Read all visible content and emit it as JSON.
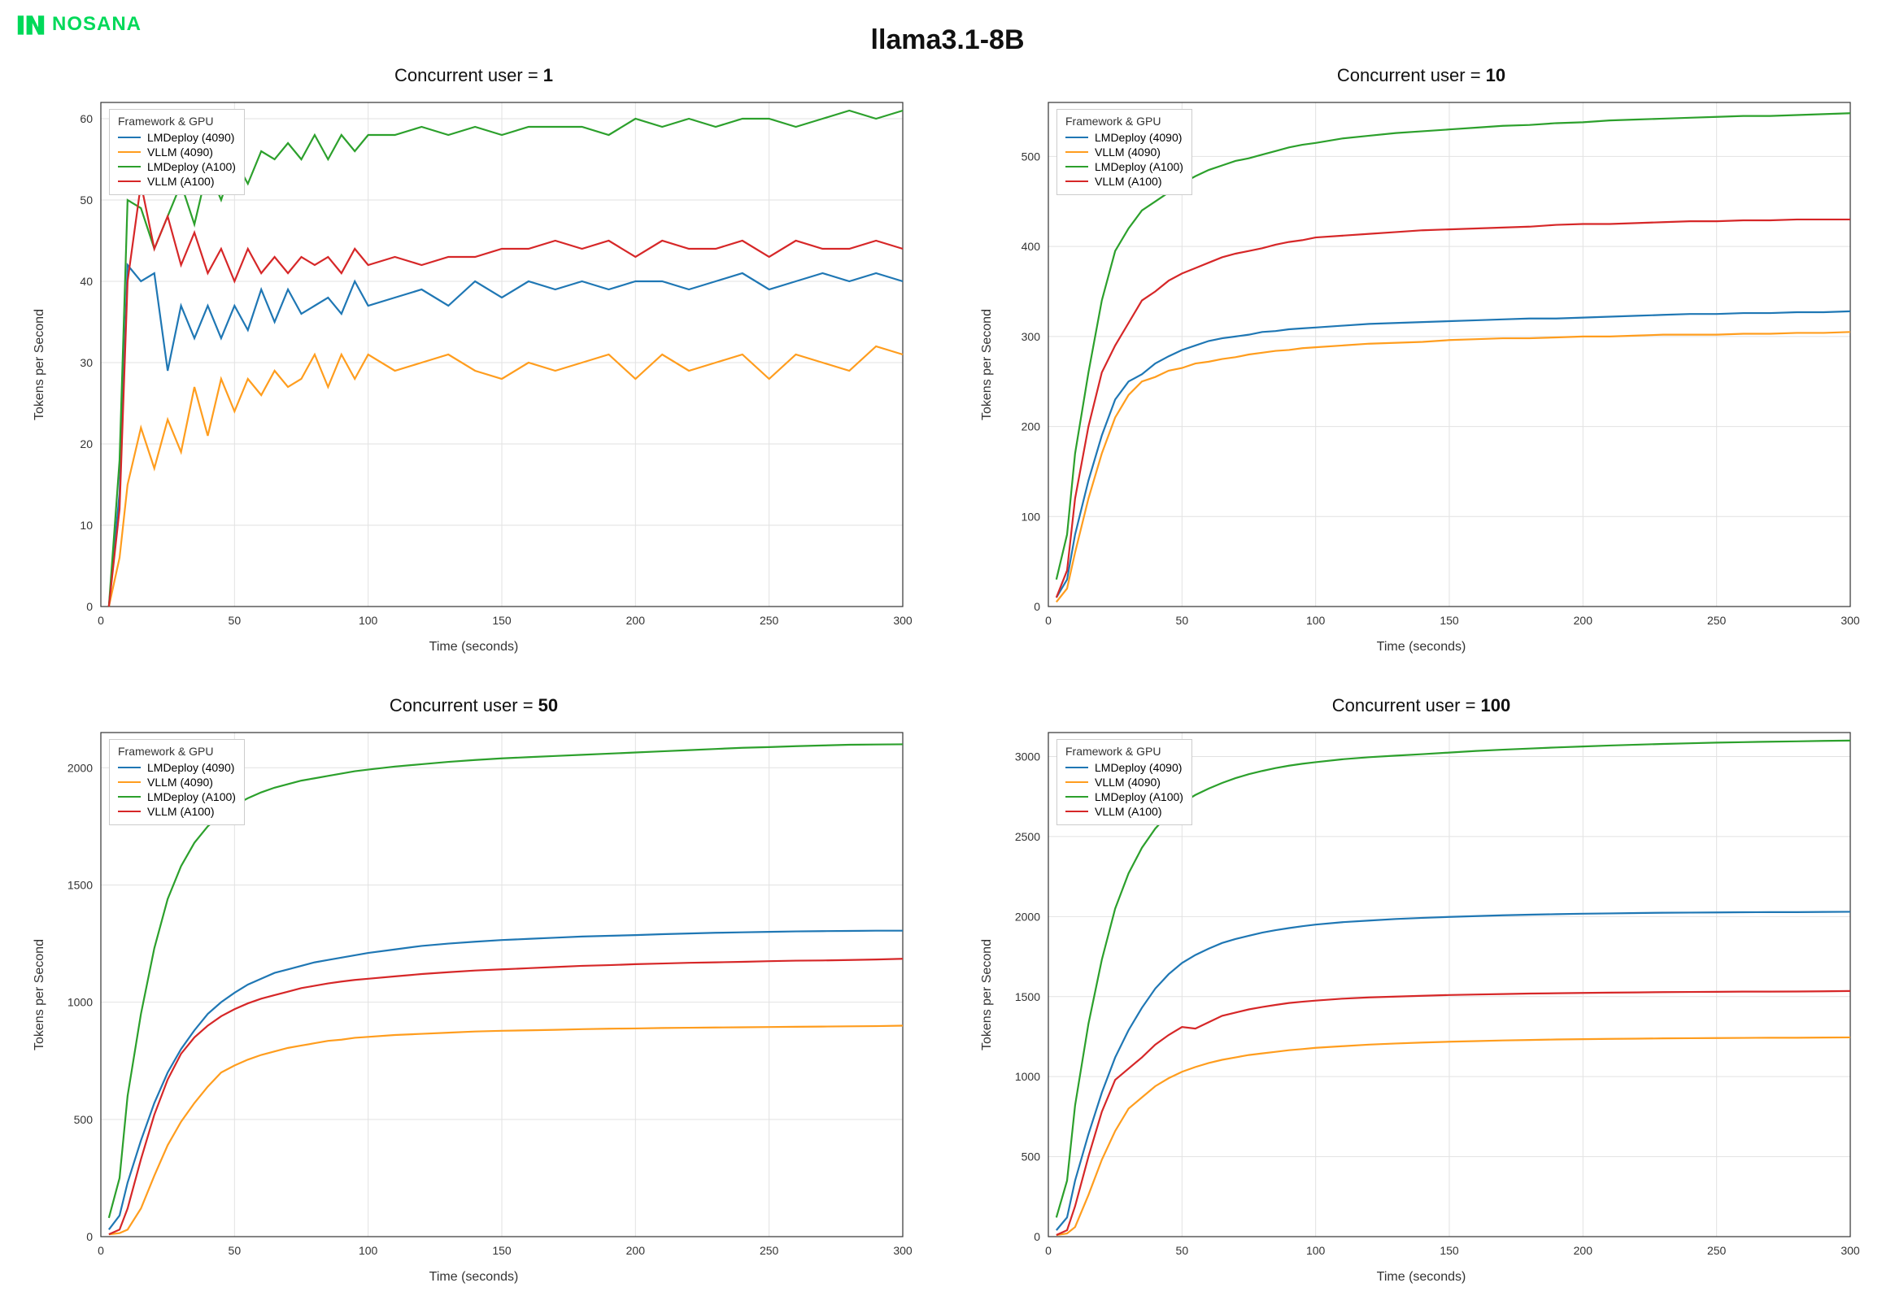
{
  "logo_text": "NOSANA",
  "super_title": "llama3.1-8B",
  "ylabel": "Tokens per Second",
  "xlabel": "Time (seconds)",
  "legend_title": "Framework & GPU",
  "colors": {
    "lmdeploy_4090": "#1f77b4",
    "vllm_4090": "#ff9d1e",
    "lmdeploy_a100": "#2ca02c",
    "vllm_a100": "#d62728"
  },
  "series_meta": [
    {
      "key": "lmdeploy_4090",
      "name": "LMDeploy (4090)"
    },
    {
      "key": "vllm_4090",
      "name": "VLLM (4090)"
    },
    {
      "key": "lmdeploy_a100",
      "name": "LMDeploy (A100)"
    },
    {
      "key": "vllm_a100",
      "name": "VLLM (A100)"
    }
  ],
  "chart_data": [
    {
      "type": "line",
      "title_prefix": "Concurrent user = ",
      "title_value": "1",
      "xlabel": "Time (seconds)",
      "ylabel": "Tokens per Second",
      "xlim": [
        0,
        300
      ],
      "ylim": [
        0,
        62
      ],
      "xticks": [
        0,
        50,
        100,
        150,
        200,
        250,
        300
      ],
      "yticks": [
        0,
        10,
        20,
        30,
        40,
        50,
        60
      ],
      "x": [
        3,
        7,
        10,
        15,
        20,
        25,
        30,
        35,
        40,
        45,
        50,
        55,
        60,
        65,
        70,
        75,
        80,
        85,
        90,
        95,
        100,
        110,
        120,
        130,
        140,
        150,
        160,
        170,
        180,
        190,
        200,
        210,
        220,
        230,
        240,
        250,
        260,
        270,
        280,
        290,
        300
      ],
      "series": [
        {
          "name": "LMDeploy (4090)",
          "key": "lmdeploy_4090",
          "values": [
            0,
            14,
            42,
            40,
            41,
            29,
            37,
            33,
            37,
            33,
            37,
            34,
            39,
            35,
            39,
            36,
            37,
            38,
            36,
            40,
            37,
            38,
            39,
            37,
            40,
            38,
            40,
            39,
            40,
            39,
            40,
            40,
            39,
            40,
            41,
            39,
            40,
            41,
            40,
            41,
            40
          ]
        },
        {
          "name": "VLLM (4090)",
          "key": "vllm_4090",
          "values": [
            0,
            6,
            15,
            22,
            17,
            23,
            19,
            27,
            21,
            28,
            24,
            28,
            26,
            29,
            27,
            28,
            31,
            27,
            31,
            28,
            31,
            29,
            30,
            31,
            29,
            28,
            30,
            29,
            30,
            31,
            28,
            31,
            29,
            30,
            31,
            28,
            31,
            30,
            29,
            32,
            31
          ]
        },
        {
          "name": "LMDeploy (A100)",
          "key": "lmdeploy_a100",
          "values": [
            0,
            18,
            50,
            49,
            44,
            48,
            52,
            47,
            54,
            50,
            55,
            52,
            56,
            55,
            57,
            55,
            58,
            55,
            58,
            56,
            58,
            58,
            59,
            58,
            59,
            58,
            59,
            59,
            59,
            58,
            60,
            59,
            60,
            59,
            60,
            60,
            59,
            60,
            61,
            60,
            61
          ]
        },
        {
          "name": "VLLM (A100)",
          "key": "vllm_a100",
          "values": [
            0,
            12,
            40,
            52,
            44,
            48,
            42,
            46,
            41,
            44,
            40,
            44,
            41,
            43,
            41,
            43,
            42,
            43,
            41,
            44,
            42,
            43,
            42,
            43,
            43,
            44,
            44,
            45,
            44,
            45,
            43,
            45,
            44,
            44,
            45,
            43,
            45,
            44,
            44,
            45,
            44
          ]
        }
      ]
    },
    {
      "type": "line",
      "title_prefix": "Concurrent user = ",
      "title_value": "10",
      "xlabel": "Time (seconds)",
      "ylabel": "Tokens per Second",
      "xlim": [
        0,
        300
      ],
      "ylim": [
        0,
        560
      ],
      "xticks": [
        0,
        50,
        100,
        150,
        200,
        250,
        300
      ],
      "yticks": [
        0,
        100,
        200,
        300,
        400,
        500
      ],
      "x": [
        3,
        7,
        10,
        15,
        20,
        25,
        30,
        35,
        40,
        45,
        50,
        55,
        60,
        65,
        70,
        75,
        80,
        85,
        90,
        95,
        100,
        110,
        120,
        130,
        140,
        150,
        160,
        170,
        180,
        190,
        200,
        210,
        220,
        230,
        240,
        250,
        260,
        270,
        280,
        290,
        300
      ],
      "series": [
        {
          "name": "LMDeploy (4090)",
          "key": "lmdeploy_4090",
          "values": [
            10,
            30,
            80,
            140,
            190,
            230,
            250,
            258,
            270,
            278,
            285,
            290,
            295,
            298,
            300,
            302,
            305,
            306,
            308,
            309,
            310,
            312,
            314,
            315,
            316,
            317,
            318,
            319,
            320,
            320,
            321,
            322,
            323,
            324,
            325,
            325,
            326,
            326,
            327,
            327,
            328
          ]
        },
        {
          "name": "VLLM (4090)",
          "key": "vllm_4090",
          "values": [
            5,
            20,
            60,
            120,
            170,
            210,
            235,
            250,
            255,
            262,
            265,
            270,
            272,
            275,
            277,
            280,
            282,
            284,
            285,
            287,
            288,
            290,
            292,
            293,
            294,
            296,
            297,
            298,
            298,
            299,
            300,
            300,
            301,
            302,
            302,
            302,
            303,
            303,
            304,
            304,
            305
          ]
        },
        {
          "name": "LMDeploy (A100)",
          "key": "lmdeploy_a100",
          "values": [
            30,
            80,
            170,
            260,
            340,
            395,
            420,
            440,
            450,
            460,
            470,
            478,
            485,
            490,
            495,
            498,
            502,
            506,
            510,
            513,
            515,
            520,
            523,
            526,
            528,
            530,
            532,
            534,
            535,
            537,
            538,
            540,
            541,
            542,
            543,
            544,
            545,
            545,
            546,
            547,
            548
          ]
        },
        {
          "name": "VLLM (A100)",
          "key": "vllm_a100",
          "values": [
            10,
            40,
            120,
            200,
            260,
            290,
            315,
            340,
            350,
            362,
            370,
            376,
            382,
            388,
            392,
            395,
            398,
            402,
            405,
            407,
            410,
            412,
            414,
            416,
            418,
            419,
            420,
            421,
            422,
            424,
            425,
            425,
            426,
            427,
            428,
            428,
            429,
            429,
            430,
            430,
            430
          ]
        }
      ]
    },
    {
      "type": "line",
      "title_prefix": "Concurrent user = ",
      "title_value": "50",
      "xlabel": "Time (seconds)",
      "ylabel": "Tokens per Second",
      "xlim": [
        0,
        300
      ],
      "ylim": [
        0,
        2150
      ],
      "xticks": [
        0,
        50,
        100,
        150,
        200,
        250,
        300
      ],
      "yticks": [
        0,
        500,
        1000,
        1500,
        2000
      ],
      "x": [
        3,
        7,
        10,
        15,
        20,
        25,
        30,
        35,
        40,
        45,
        50,
        55,
        60,
        65,
        70,
        75,
        80,
        85,
        90,
        95,
        100,
        110,
        120,
        130,
        140,
        150,
        160,
        170,
        180,
        190,
        200,
        210,
        220,
        230,
        240,
        250,
        260,
        270,
        280,
        290,
        300
      ],
      "series": [
        {
          "name": "LMDeploy (4090)",
          "key": "lmdeploy_4090",
          "values": [
            30,
            90,
            230,
            410,
            570,
            700,
            800,
            880,
            950,
            1000,
            1040,
            1075,
            1100,
            1125,
            1140,
            1155,
            1170,
            1180,
            1190,
            1200,
            1210,
            1225,
            1240,
            1250,
            1258,
            1265,
            1270,
            1275,
            1280,
            1283,
            1286,
            1290,
            1293,
            1296,
            1298,
            1300,
            1302,
            1303,
            1304,
            1305,
            1305
          ]
        },
        {
          "name": "VLLM (4090)",
          "key": "vllm_4090",
          "values": [
            10,
            15,
            30,
            120,
            260,
            390,
            490,
            570,
            640,
            700,
            730,
            755,
            775,
            790,
            805,
            815,
            825,
            835,
            840,
            848,
            852,
            860,
            865,
            870,
            875,
            878,
            880,
            882,
            885,
            887,
            888,
            890,
            891,
            892,
            893,
            894,
            895,
            896,
            897,
            898,
            900
          ]
        },
        {
          "name": "LMDeploy (A100)",
          "key": "lmdeploy_a100",
          "values": [
            80,
            250,
            600,
            950,
            1230,
            1440,
            1580,
            1680,
            1750,
            1800,
            1840,
            1870,
            1895,
            1915,
            1930,
            1945,
            1955,
            1965,
            1975,
            1985,
            1992,
            2005,
            2015,
            2025,
            2033,
            2040,
            2045,
            2050,
            2055,
            2060,
            2065,
            2070,
            2075,
            2080,
            2085,
            2088,
            2092,
            2095,
            2098,
            2099,
            2100
          ]
        },
        {
          "name": "VLLM (A100)",
          "key": "vllm_a100",
          "values": [
            10,
            30,
            120,
            330,
            520,
            670,
            780,
            850,
            900,
            940,
            970,
            995,
            1015,
            1030,
            1045,
            1060,
            1070,
            1080,
            1088,
            1095,
            1100,
            1110,
            1120,
            1128,
            1135,
            1140,
            1145,
            1150,
            1155,
            1158,
            1162,
            1165,
            1168,
            1170,
            1172,
            1175,
            1177,
            1178,
            1180,
            1182,
            1185
          ]
        }
      ]
    },
    {
      "type": "line",
      "title_prefix": "Concurrent user = ",
      "title_value": "100",
      "xlabel": "Time (seconds)",
      "ylabel": "Tokens per Second",
      "xlim": [
        0,
        300
      ],
      "ylim": [
        0,
        3150
      ],
      "xticks": [
        0,
        50,
        100,
        150,
        200,
        250,
        300
      ],
      "yticks": [
        0,
        500,
        1000,
        1500,
        2000,
        2500,
        3000
      ],
      "x": [
        3,
        7,
        10,
        15,
        20,
        25,
        30,
        35,
        40,
        45,
        50,
        55,
        60,
        65,
        70,
        75,
        80,
        85,
        90,
        95,
        100,
        110,
        120,
        130,
        140,
        150,
        160,
        170,
        180,
        190,
        200,
        210,
        220,
        230,
        240,
        250,
        260,
        270,
        280,
        290,
        300
      ],
      "series": [
        {
          "name": "LMDeploy (4090)",
          "key": "lmdeploy_4090",
          "values": [
            40,
            120,
            350,
            640,
            900,
            1120,
            1290,
            1430,
            1550,
            1640,
            1710,
            1760,
            1800,
            1835,
            1860,
            1880,
            1900,
            1915,
            1928,
            1940,
            1950,
            1965,
            1975,
            1985,
            1992,
            1998,
            2003,
            2008,
            2012,
            2015,
            2018,
            2020,
            2022,
            2024,
            2025,
            2026,
            2027,
            2028,
            2028,
            2029,
            2030
          ]
        },
        {
          "name": "VLLM (4090)",
          "key": "vllm_4090",
          "values": [
            10,
            20,
            60,
            260,
            480,
            660,
            800,
            870,
            940,
            990,
            1030,
            1060,
            1085,
            1105,
            1120,
            1135,
            1145,
            1155,
            1165,
            1172,
            1180,
            1190,
            1200,
            1207,
            1213,
            1218,
            1222,
            1226,
            1229,
            1232,
            1234,
            1236,
            1237,
            1239,
            1240,
            1241,
            1242,
            1243,
            1243,
            1244,
            1245
          ]
        },
        {
          "name": "LMDeploy (A100)",
          "key": "lmdeploy_a100",
          "values": [
            120,
            350,
            820,
            1330,
            1730,
            2050,
            2270,
            2430,
            2550,
            2640,
            2710,
            2760,
            2800,
            2835,
            2865,
            2890,
            2910,
            2928,
            2943,
            2955,
            2965,
            2983,
            2996,
            3006,
            3015,
            3025,
            3035,
            3043,
            3050,
            3057,
            3063,
            3069,
            3074,
            3079,
            3083,
            3087,
            3090,
            3093,
            3095,
            3098,
            3100
          ]
        },
        {
          "name": "VLLM (A100)",
          "key": "vllm_a100",
          "values": [
            10,
            40,
            190,
            500,
            780,
            980,
            1050,
            1120,
            1200,
            1260,
            1310,
            1300,
            1340,
            1380,
            1400,
            1420,
            1435,
            1448,
            1460,
            1468,
            1475,
            1487,
            1495,
            1500,
            1505,
            1510,
            1513,
            1516,
            1519,
            1521,
            1523,
            1525,
            1526,
            1528,
            1529,
            1530,
            1531,
            1531,
            1532,
            1533,
            1535
          ]
        }
      ]
    }
  ]
}
